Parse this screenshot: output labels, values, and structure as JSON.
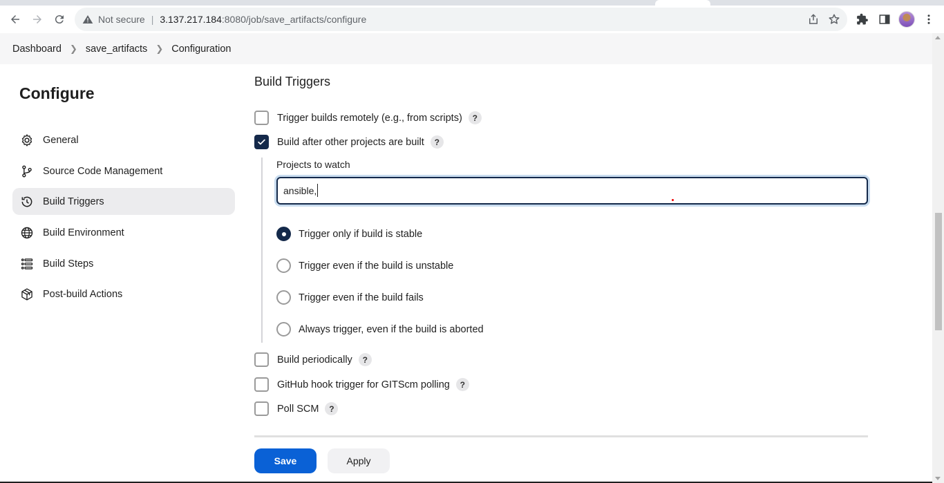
{
  "browser": {
    "not_secure": "Not secure",
    "url_host": "3.137.217.184",
    "url_path": ":8080/job/save_artifacts/configure"
  },
  "breadcrumb": {
    "items": [
      "Dashboard",
      "save_artifacts",
      "Configuration"
    ]
  },
  "sidebar": {
    "title": "Configure",
    "items": [
      {
        "label": "General",
        "icon": "gear-icon"
      },
      {
        "label": "Source Code Management",
        "icon": "branch-icon"
      },
      {
        "label": "Build Triggers",
        "icon": "clock-icon"
      },
      {
        "label": "Build Environment",
        "icon": "globe-icon"
      },
      {
        "label": "Build Steps",
        "icon": "list-icon"
      },
      {
        "label": "Post-build Actions",
        "icon": "package-icon"
      }
    ]
  },
  "main": {
    "section_title": "Build Triggers",
    "options": [
      {
        "label": "Trigger builds remotely (e.g., from scripts)",
        "checked": false
      },
      {
        "label": "Build after other projects are built",
        "checked": true
      }
    ],
    "projects_label": "Projects to watch",
    "projects_value": "ansible,",
    "radio_options": [
      {
        "label": "Trigger only if build is stable",
        "checked": true
      },
      {
        "label": "Trigger even if the build is unstable",
        "checked": false
      },
      {
        "label": "Trigger even if the build fails",
        "checked": false
      },
      {
        "label": "Always trigger, even if the build is aborted",
        "checked": false
      }
    ],
    "more_options": [
      {
        "label": "Build periodically",
        "checked": false
      },
      {
        "label": "GitHub hook trigger for GITScm polling",
        "checked": false
      },
      {
        "label": "Poll SCM",
        "checked": false
      }
    ],
    "help_glyph": "?"
  },
  "footer": {
    "save_label": "Save",
    "apply_label": "Apply"
  },
  "colors": {
    "accent": "#14294a",
    "save_button": "#0a61d6"
  }
}
